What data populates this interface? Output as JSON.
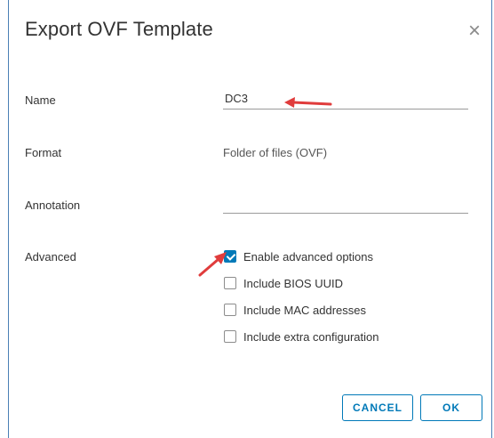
{
  "dialog": {
    "title": "Export OVF Template",
    "close_icon": "close-icon",
    "close_glyph": "×"
  },
  "form": {
    "name_label": "Name",
    "name_value": "DC3",
    "format_label": "Format",
    "format_value": "Folder of files (OVF)",
    "annotation_label": "Annotation",
    "annotation_value": "",
    "advanced_label": "Advanced",
    "options": [
      {
        "label": "Enable advanced options",
        "checked": true
      },
      {
        "label": "Include BIOS UUID",
        "checked": false
      },
      {
        "label": "Include MAC addresses",
        "checked": false
      },
      {
        "label": "Include extra configuration",
        "checked": false
      }
    ]
  },
  "buttons": {
    "cancel_label": "CANCEL",
    "ok_label": "OK"
  },
  "colors": {
    "accent": "#0079b8",
    "annotation_arrow": "#e03c3c",
    "window_border": "#4a7fb5"
  }
}
